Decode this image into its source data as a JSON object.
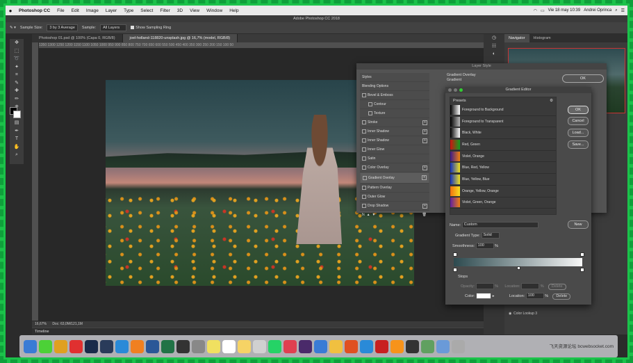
{
  "menubar": {
    "apple": "",
    "items": [
      "Photoshop CC",
      "File",
      "Edit",
      "Image",
      "Layer",
      "Type",
      "Select",
      "Filter",
      "3D",
      "View",
      "Window",
      "Help"
    ],
    "clock": "Vie 18 may  10:39",
    "user": "Andrei Oprinca"
  },
  "window_title": "Adobe Photoshop CC 2018",
  "options": {
    "sample_size_label": "Sample Size:",
    "sample_size_value": "3 by 3 Average",
    "sample_label": "Sample:",
    "sample_value": "All Layers",
    "show_ring_label": "Show Sampling Ring"
  },
  "doc_tabs": [
    {
      "label": "Photoshop 01.psd @ 100% (Capa 0, RGB/8)",
      "active": false
    },
    {
      "label": "joel-holland-118820-unsplash.jpg @ 16,7% (model, RGB/8)",
      "active": true
    }
  ],
  "ruler_ticks": "1350  1300  1250  1200  1150  1100  1050  1000  950  900  850  800  750  700  650  600  550  500  450  400  350  300  250  200  150  100  50",
  "status": {
    "zoom": "16,67%",
    "doc": "Doc: 63,0M/121,1M"
  },
  "timeline_label": "Timeline",
  "right_panel": {
    "tabs": [
      "Navigator",
      "Histogram"
    ],
    "layer_label": "Color Lookup 3"
  },
  "layer_style": {
    "title": "Layer Style",
    "header": "Styles",
    "rows": [
      {
        "label": "Blending Options",
        "type": "plain"
      },
      {
        "label": "Bevel & Emboss",
        "type": "check"
      },
      {
        "label": "Contour",
        "type": "sub"
      },
      {
        "label": "Texture",
        "type": "sub"
      },
      {
        "label": "Stroke",
        "type": "plus"
      },
      {
        "label": "Inner Shadow",
        "type": "plus"
      },
      {
        "label": "Inner Shadow",
        "type": "plus"
      },
      {
        "label": "Inner Glow",
        "type": "check"
      },
      {
        "label": "Satin",
        "type": "check"
      },
      {
        "label": "Color Overlay",
        "type": "plus"
      },
      {
        "label": "Gradient Overlay",
        "type": "plus",
        "selected": true
      },
      {
        "label": "Pattern Overlay",
        "type": "check"
      },
      {
        "label": "Outer Glow",
        "type": "check"
      },
      {
        "label": "Drop Shadow",
        "type": "plus"
      }
    ],
    "section_title": "Gradient Overlay",
    "section_sub": "Gradient",
    "ok_label": "OK"
  },
  "gradient_editor": {
    "title": "Gradient Editor",
    "presets_label": "Presets",
    "presets": [
      {
        "label": "Foreground to Background",
        "c1": "#000000",
        "c2": "#ffffff"
      },
      {
        "label": "Foreground to Transparent",
        "c1": "#000000",
        "c2": "#b8b8b8"
      },
      {
        "label": "Black, White",
        "c1": "#000000",
        "c2": "#ffffff"
      },
      {
        "label": "Red, Green",
        "c1": "#d01010",
        "c2": "#10a020"
      },
      {
        "label": "Violet, Orange",
        "c1": "#3a1a8a",
        "c2": "#f08010"
      },
      {
        "label": "Blue, Red, Yellow",
        "c1": "#1030c0",
        "c2": "#f0e020"
      },
      {
        "label": "Blue, Yellow, Blue",
        "c1": "#1030c0",
        "c2": "#f0e020"
      },
      {
        "label": "Orange, Yellow, Orange",
        "c1": "#f07010",
        "c2": "#f8e020"
      },
      {
        "label": "Violet, Green, Orange",
        "c1": "#6020a0",
        "c2": "#f08010"
      }
    ],
    "buttons": {
      "ok": "OK",
      "cancel": "Cancel",
      "load": "Load...",
      "save": "Save..."
    },
    "name_label": "Name:",
    "name_value": "Custom",
    "new_label": "New",
    "type_label": "Gradient Type:",
    "type_value": "Solid",
    "smooth_label": "Smoothness:",
    "smooth_value": "100",
    "percent": "%",
    "stops_label": "Stops",
    "opacity_label": "Opacity:",
    "location_label": "Location:",
    "delete_label": "Delete",
    "color_label": "Color:",
    "location_value": "100",
    "gradient_start": "#2d4a4f",
    "gradient_end": "#f7f7f7"
  },
  "dock": {
    "icons": [
      "finder",
      "messages",
      "chrome",
      "opera",
      "photoshop",
      "lightroom",
      "safari",
      "vlc",
      "word",
      "excel",
      "activity",
      "settings",
      "stickies",
      "calendar",
      "notes",
      "chrome2",
      "whatsapp",
      "claquette",
      "audition",
      "preview",
      "linux",
      "reeder",
      "safari2",
      "filezilla",
      "bitcoin",
      "coinapp",
      "pinwheel",
      "mail",
      "trash"
    ],
    "icon_colors": [
      "#3a7bd5",
      "#4cd137",
      "#e0a020",
      "#e03030",
      "#1a2b4a",
      "#2a3b5a",
      "#2a8ad8",
      "#f08020",
      "#2b5797",
      "#217346",
      "#333333",
      "#888888",
      "#f0e060",
      "#ffffff",
      "#f6d365",
      "#d0d0d0",
      "#25d366",
      "#e04050",
      "#4a2a6a",
      "#3a7bd5",
      "#f0c040",
      "#e05020",
      "#2a8ad8",
      "#c82020",
      "#f7931a",
      "#333333",
      "#60a060",
      "#6a9ad8",
      "#aaaaaa"
    ],
    "watermark": "飞天资源论坛 bcwebsocket.com"
  }
}
